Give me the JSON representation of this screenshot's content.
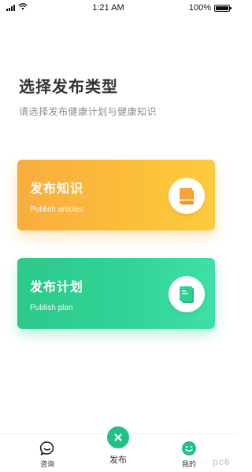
{
  "status_bar": {
    "time": "1:21 AM",
    "battery": "100%",
    "battery_level": 1.0
  },
  "header": {
    "title": "选择发布类型",
    "subtitle": "请选择发布健康计划与健康知识"
  },
  "cards": [
    {
      "title": "发布知识",
      "subtitle": "Publish articles",
      "icon": "book-icon",
      "color": "#f9b33d"
    },
    {
      "title": "发布计划",
      "subtitle": "Publish plan",
      "icon": "notebook-icon",
      "color": "#31d397"
    }
  ],
  "tab_bar": {
    "consult_label": "咨询",
    "publish_label": "发布",
    "mine_label": "我的",
    "accent": "#21c184"
  },
  "watermark": "pc6"
}
